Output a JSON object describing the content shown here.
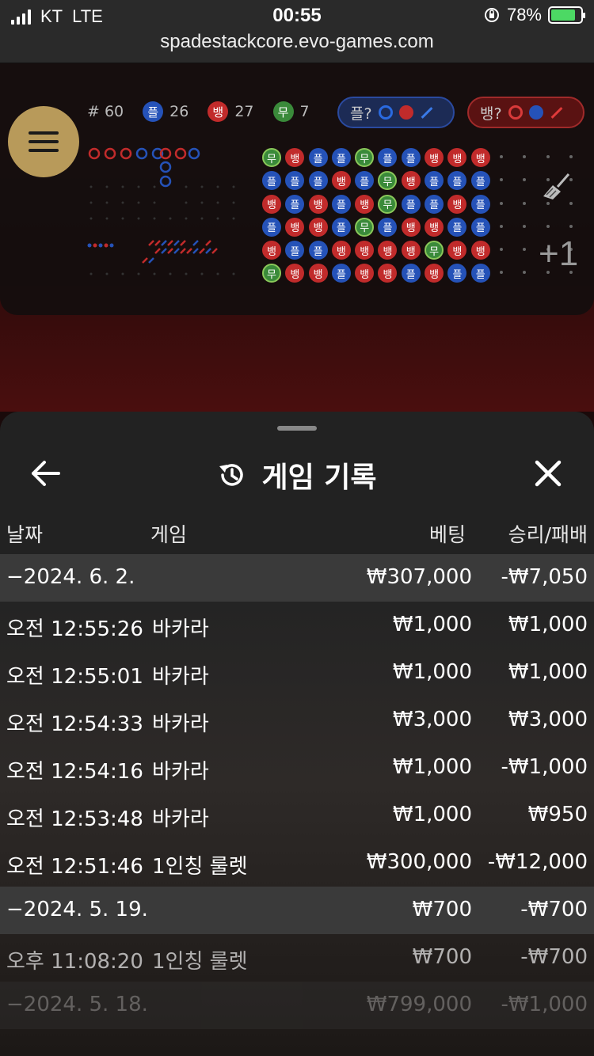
{
  "status": {
    "carrier": "KT",
    "network": "LTE",
    "time": "00:55",
    "battery": "78%"
  },
  "url": "spadestackcore.evo-games.com",
  "game": {
    "stats": {
      "round": "# 60",
      "player_label": "플",
      "player_count": "26",
      "banker_label": "뱅",
      "banker_count": "27",
      "tie_label": "무",
      "tie_count": "7"
    },
    "player_ask": "플?",
    "banker_ask": "뱅?",
    "plus_one": "+1",
    "bead_road": [
      [
        "무",
        "뱅",
        "플",
        "플",
        "무",
        "플",
        "플",
        "뱅",
        "뱅",
        "뱅"
      ],
      [
        "플",
        "플",
        "플",
        "뱅",
        "플",
        "무",
        "뱅",
        "플",
        "플",
        "플"
      ],
      [
        "뱅",
        "플",
        "뱅",
        "플",
        "뱅",
        "무",
        "플",
        "플",
        "뱅",
        "플"
      ],
      [
        "플",
        "뱅",
        "뱅",
        "플",
        "무",
        "플",
        "뱅",
        "뱅",
        "플",
        "플"
      ],
      [
        "뱅",
        "플",
        "플",
        "뱅",
        "뱅",
        "뱅",
        "뱅",
        "무",
        "뱅",
        "뱅"
      ],
      [
        "무",
        "뱅",
        "뱅",
        "플",
        "뱅",
        "뱅",
        "플",
        "뱅",
        "플",
        "플"
      ]
    ]
  },
  "history": {
    "title": "게임 기록",
    "columns": {
      "date": "날짜",
      "game": "게임",
      "bet": "베팅",
      "result": "승리/패배"
    },
    "rows": [
      {
        "type": "date",
        "date": "−2024. 6. 2.",
        "bet": "₩307,000",
        "result": "-₩7,050"
      },
      {
        "type": "item",
        "time": "오전 12:55:26",
        "game": "바카라",
        "bet": "₩1,000",
        "result": "₩1,000"
      },
      {
        "type": "item",
        "time": "오전 12:55:01",
        "game": "바카라",
        "bet": "₩1,000",
        "result": "₩1,000"
      },
      {
        "type": "item",
        "time": "오전 12:54:33",
        "game": "바카라",
        "bet": "₩3,000",
        "result": "₩3,000"
      },
      {
        "type": "item",
        "time": "오전 12:54:16",
        "game": "바카라",
        "bet": "₩1,000",
        "result": "-₩1,000"
      },
      {
        "type": "item",
        "time": "오전 12:53:48",
        "game": "바카라",
        "bet": "₩1,000",
        "result": "₩950"
      },
      {
        "type": "item",
        "time": "오전 12:51:46",
        "game": "1인칭 룰렛",
        "bet": "₩300,000",
        "result": "-₩12,000"
      },
      {
        "type": "date",
        "date": "−2024. 5. 19.",
        "bet": "₩700",
        "result": "-₩700"
      },
      {
        "type": "item",
        "time": "오후 11:08:20",
        "game": "1인칭 룰렛",
        "bet": "₩700",
        "result": "-₩700"
      },
      {
        "type": "date",
        "date": "−2024. 5. 18.",
        "bet": "₩799,000",
        "result": "-₩1,000"
      }
    ]
  },
  "colors": {
    "player": "#2552b8",
    "banker": "#c12b2b",
    "tie": "#3a8a3a",
    "menu_gold": "#b89a5a"
  }
}
